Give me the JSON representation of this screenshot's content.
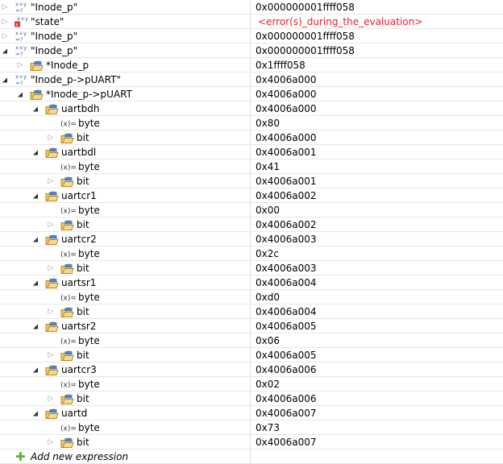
{
  "rows": [
    {
      "level": 0,
      "toggle": "collapsed",
      "icon": "expression",
      "name": "\"Inode_p\"",
      "value": "0x000000001ffff058"
    },
    {
      "level": 0,
      "toggle": "collapsed",
      "icon": "expression-error",
      "name": "\"state\"",
      "value": "<error(s)_during_the_evaluation>",
      "error": true
    },
    {
      "level": 0,
      "toggle": "collapsed",
      "icon": "expression",
      "name": "\"Inode_p\"",
      "value": "0x000000001ffff058"
    },
    {
      "level": 0,
      "toggle": "expanded",
      "icon": "expression",
      "name": "\"Inode_p\"",
      "value": "0x000000001ffff058"
    },
    {
      "level": 1,
      "toggle": "collapsed",
      "icon": "struct",
      "name": "*Inode_p",
      "value": "0x1ffff058"
    },
    {
      "level": 0,
      "toggle": "expanded",
      "icon": "expression",
      "name": "\"Inode_p->pUART\"",
      "value": "0x4006a000"
    },
    {
      "level": 1,
      "toggle": "expanded",
      "icon": "struct",
      "name": "*Inode_p->pUART",
      "value": "0x4006a000"
    },
    {
      "level": 2,
      "toggle": "expanded",
      "icon": "struct",
      "name": "uartbdh",
      "value": "0x4006a000"
    },
    {
      "level": 3,
      "toggle": "none",
      "icon": "variable",
      "name": "byte",
      "value": "0x80"
    },
    {
      "level": 3,
      "toggle": "collapsed",
      "icon": "struct",
      "name": "bit",
      "value": "0x4006a000"
    },
    {
      "level": 2,
      "toggle": "expanded",
      "icon": "struct",
      "name": "uartbdl",
      "value": "0x4006a001"
    },
    {
      "level": 3,
      "toggle": "none",
      "icon": "variable",
      "name": "byte",
      "value": "0x41"
    },
    {
      "level": 3,
      "toggle": "collapsed",
      "icon": "struct",
      "name": "bit",
      "value": "0x4006a001"
    },
    {
      "level": 2,
      "toggle": "expanded",
      "icon": "struct",
      "name": "uartcr1",
      "value": "0x4006a002"
    },
    {
      "level": 3,
      "toggle": "none",
      "icon": "variable",
      "name": "byte",
      "value": "0x00"
    },
    {
      "level": 3,
      "toggle": "collapsed",
      "icon": "struct",
      "name": "bit",
      "value": "0x4006a002"
    },
    {
      "level": 2,
      "toggle": "expanded",
      "icon": "struct",
      "name": "uartcr2",
      "value": "0x4006a003"
    },
    {
      "level": 3,
      "toggle": "none",
      "icon": "variable",
      "name": "byte",
      "value": "0x2c"
    },
    {
      "level": 3,
      "toggle": "collapsed",
      "icon": "struct",
      "name": "bit",
      "value": "0x4006a003"
    },
    {
      "level": 2,
      "toggle": "expanded",
      "icon": "struct",
      "name": "uartsr1",
      "value": "0x4006a004"
    },
    {
      "level": 3,
      "toggle": "none",
      "icon": "variable",
      "name": "byte",
      "value": "0xd0"
    },
    {
      "level": 3,
      "toggle": "collapsed",
      "icon": "struct",
      "name": "bit",
      "value": "0x4006a004"
    },
    {
      "level": 2,
      "toggle": "expanded",
      "icon": "struct",
      "name": "uartsr2",
      "value": "0x4006a005"
    },
    {
      "level": 3,
      "toggle": "none",
      "icon": "variable",
      "name": "byte",
      "value": "0x06"
    },
    {
      "level": 3,
      "toggle": "collapsed",
      "icon": "struct",
      "name": "bit",
      "value": "0x4006a005"
    },
    {
      "level": 2,
      "toggle": "expanded",
      "icon": "struct",
      "name": "uartcr3",
      "value": "0x4006a006"
    },
    {
      "level": 3,
      "toggle": "none",
      "icon": "variable",
      "name": "byte",
      "value": "0x02"
    },
    {
      "level": 3,
      "toggle": "collapsed",
      "icon": "struct",
      "name": "bit",
      "value": "0x4006a006"
    },
    {
      "level": 2,
      "toggle": "expanded",
      "icon": "struct",
      "name": "uartd",
      "value": "0x4006a007"
    },
    {
      "level": 3,
      "toggle": "none",
      "icon": "variable",
      "name": "byte",
      "value": "0x73"
    },
    {
      "level": 3,
      "toggle": "collapsed",
      "icon": "struct",
      "name": "bit",
      "value": "0x4006a007"
    }
  ],
  "add_expression": {
    "label": "Add new expression",
    "icon": "plus-icon"
  },
  "colors": {
    "error": "#e8202a",
    "add": "#5cb531"
  }
}
